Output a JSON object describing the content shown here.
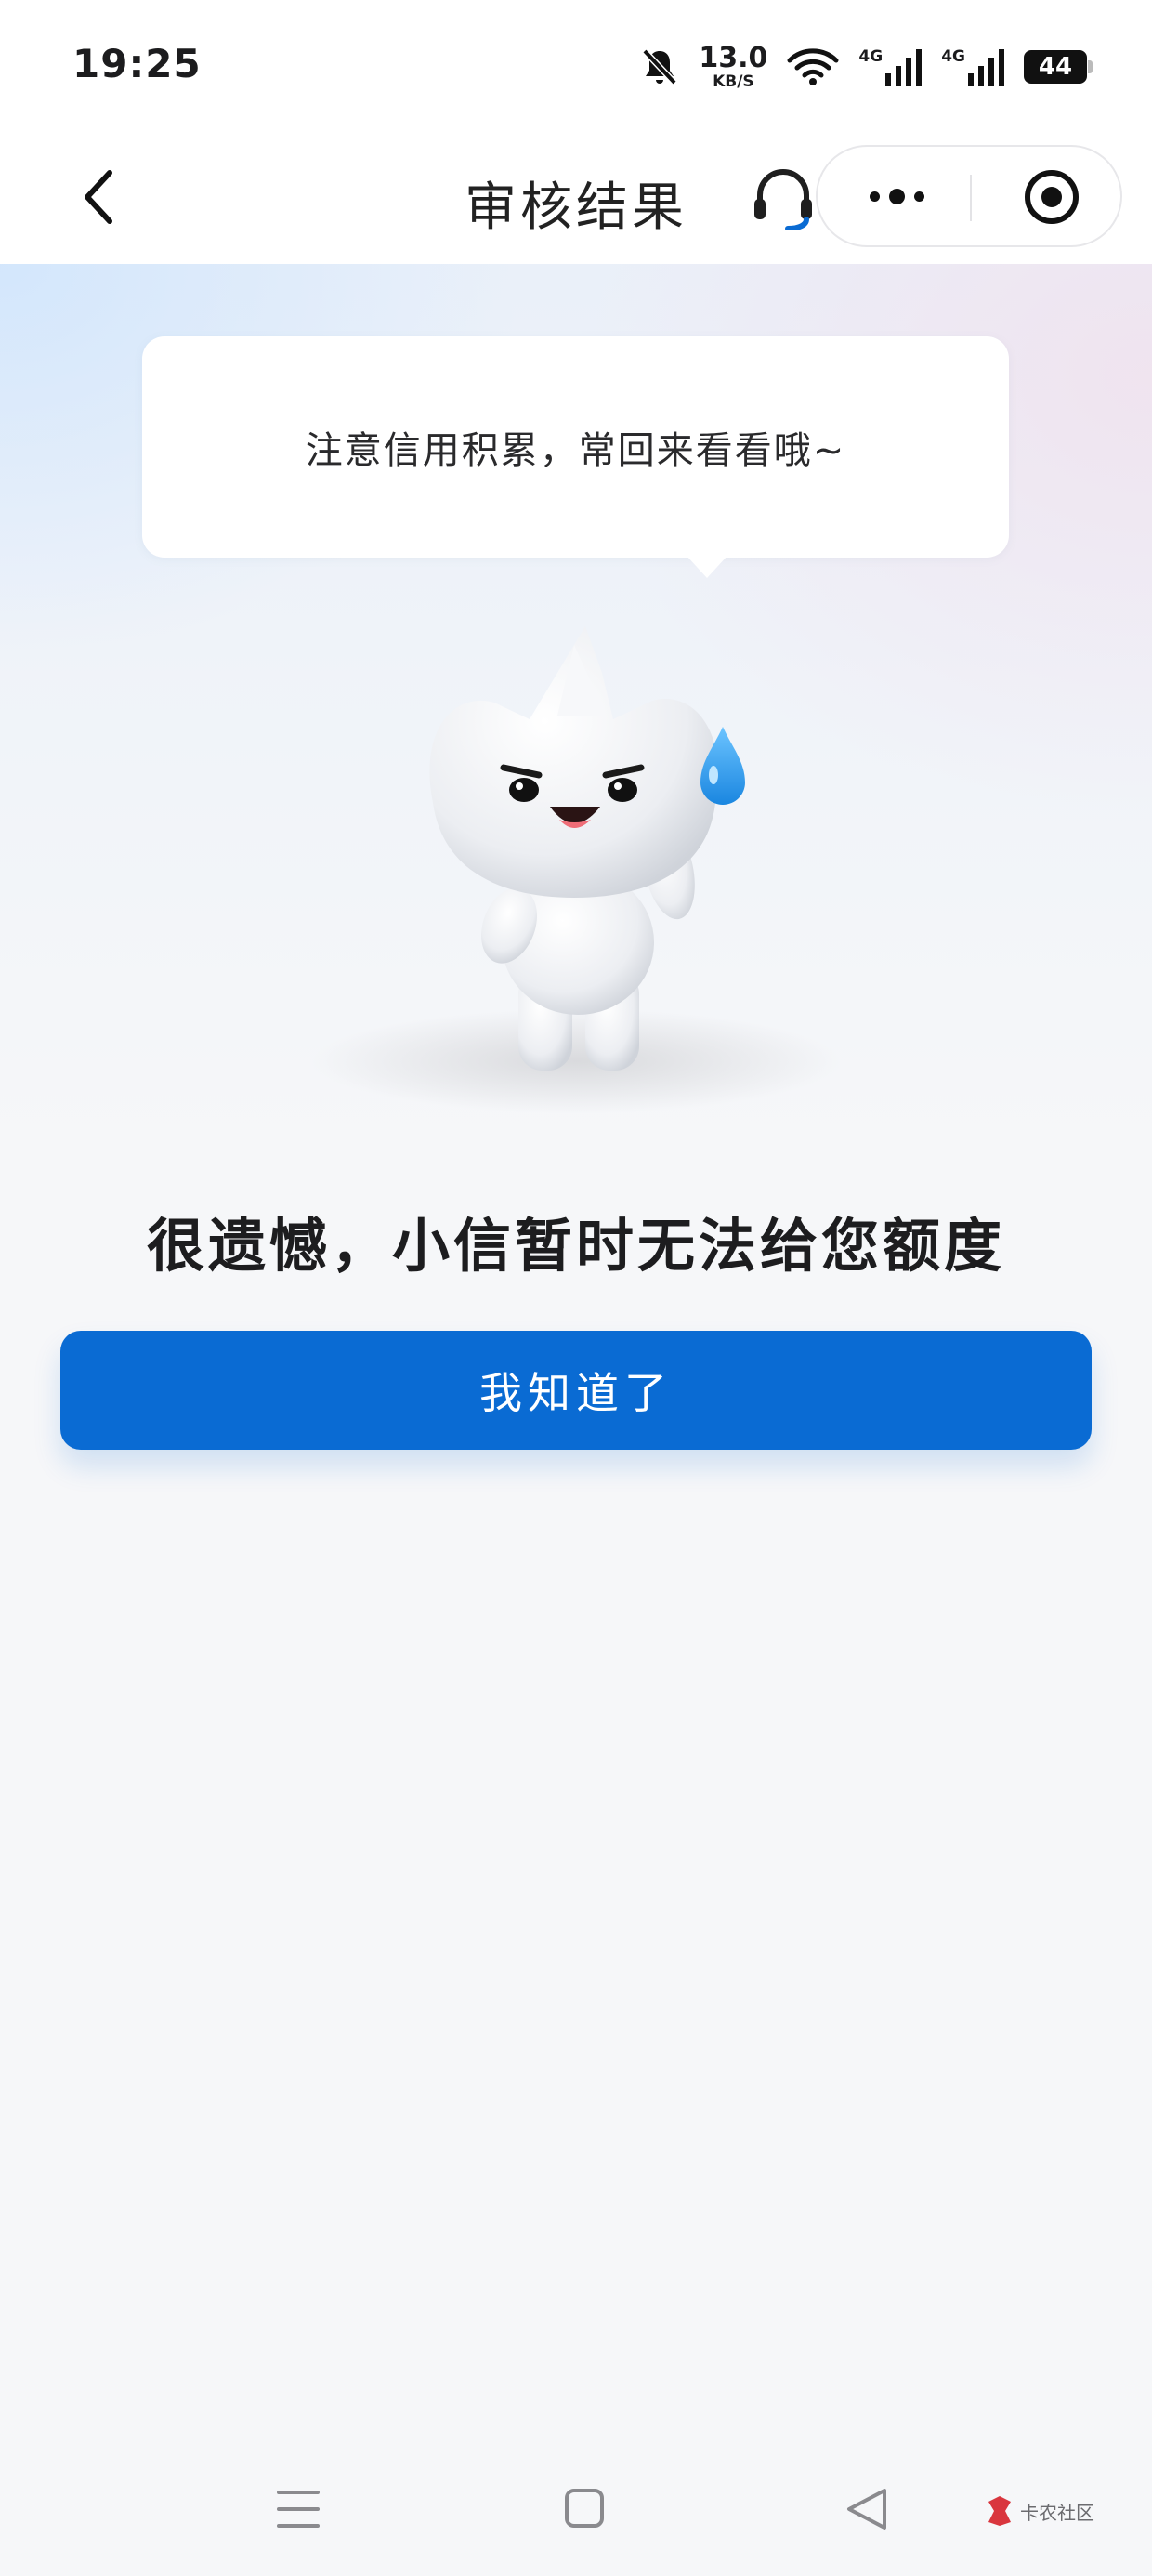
{
  "status_bar": {
    "time": "19:25",
    "net_speed_value": "13.0",
    "net_speed_unit": "KB/S",
    "signal_1_label": "4G",
    "signal_2_label": "4G",
    "battery_level": "44"
  },
  "nav": {
    "title": "审核结果",
    "back_icon": "chevron-left-icon",
    "service_icon": "headset-icon",
    "more_icon": "more-dots-icon",
    "close_icon": "target-circle-icon"
  },
  "bubble": {
    "text": "注意信用积累，常回来看看哦~"
  },
  "result": {
    "title": "很遗憾，小信暂时无法给您额度"
  },
  "action": {
    "button_label": "我知道了"
  },
  "colors": {
    "primary": "#0a6bd3",
    "sweat_drop": "#2a98ea"
  },
  "watermark": {
    "text": "卡农社区"
  }
}
